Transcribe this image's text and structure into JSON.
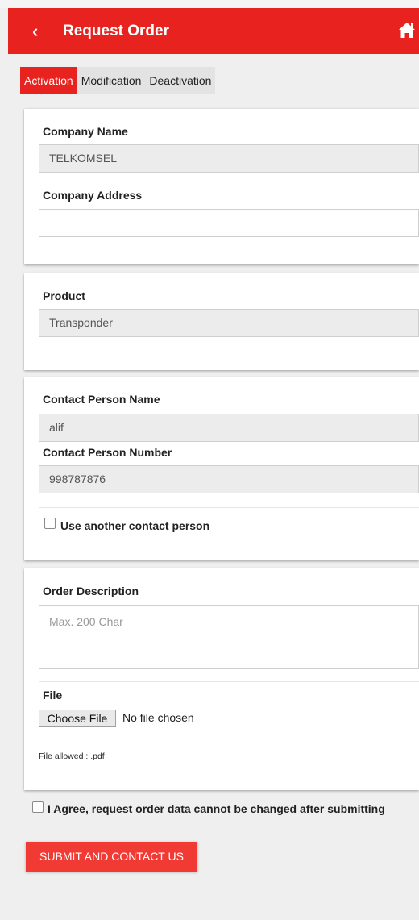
{
  "appbar": {
    "title": "Request Order",
    "back_icon": "‹",
    "home_icon": "home-icon"
  },
  "tabs": [
    {
      "label": "Activation",
      "active": true
    },
    {
      "label": "Modification",
      "active": false
    },
    {
      "label": "Deactivation",
      "active": false
    }
  ],
  "company": {
    "name_label": "Company Name",
    "name_value": "TELKOMSEL",
    "address_label": "Company Address",
    "address_value": ""
  },
  "product": {
    "label": "Product",
    "value": "Transponder"
  },
  "contact": {
    "name_label": "Contact Person Name",
    "name_value": "alif",
    "number_label": "Contact Person Number",
    "number_value": "998787876",
    "other_label": "Use another contact person",
    "other_checked": false
  },
  "order": {
    "desc_label": "Order Description",
    "desc_placeholder": "Max. 200 Char",
    "file_label": "File",
    "file_button": "Choose File",
    "file_status": "No file chosen",
    "file_allowed": "File allowed : .pdf"
  },
  "agree": {
    "label": "I Agree, request order data cannot be changed after submitting",
    "checked": false
  },
  "submit_label": "SUBMIT AND CONTACT US",
  "colors": {
    "accent": "#e8231f",
    "submit": "#f23a35"
  }
}
